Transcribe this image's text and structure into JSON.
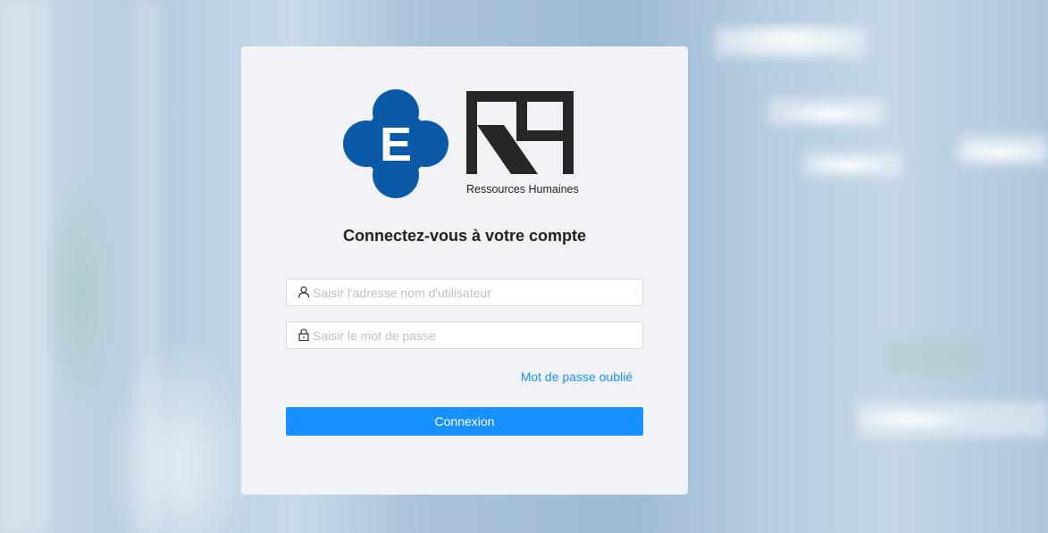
{
  "logo": {
    "emblem_letter": "E",
    "brand_tagline": "Ressources Humaines"
  },
  "login": {
    "title": "Connectez-vous à votre compte",
    "username_placeholder": "Saisir l'adresse nom d'utilisateur",
    "username_value": "",
    "password_placeholder": "Saisir le mot de passe",
    "password_value": "",
    "forgot_password_label": "Mot de passe oublié",
    "submit_label": "Connexion"
  },
  "icons": {
    "username": "user-icon",
    "password": "lock-icon"
  },
  "colors": {
    "brand_blue": "#0a5aa8",
    "logo_dark": "#262626",
    "primary_button": "#1890ff",
    "link": "#1890ff",
    "card_background": "#f0f2f5"
  }
}
